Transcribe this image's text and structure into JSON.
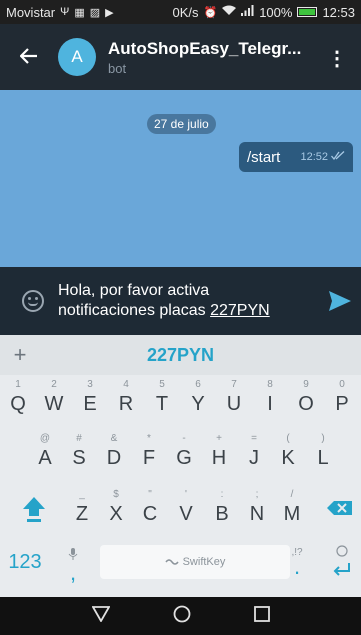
{
  "status": {
    "carrier": "Movistar",
    "speed": "0K/s",
    "battery": "100%",
    "time": "12:53"
  },
  "header": {
    "avatar_letter": "A",
    "title": "AutoShopEasy_Telegr...",
    "subtitle": "bot"
  },
  "chat": {
    "date": "27 de julio",
    "messages": [
      {
        "text": "/start",
        "time": "12:52"
      }
    ]
  },
  "composer": {
    "line1": "Hola, por favor activa",
    "line2_prefix": "notificaciones placas ",
    "line2_underlined": "227PYN"
  },
  "keyboard": {
    "suggestion": "227PYN",
    "plus": "+",
    "row1": [
      {
        "sub": "1",
        "key": "Q"
      },
      {
        "sub": "2",
        "key": "W"
      },
      {
        "sub": "3",
        "key": "E"
      },
      {
        "sub": "4",
        "key": "R"
      },
      {
        "sub": "5",
        "key": "T"
      },
      {
        "sub": "6",
        "key": "Y"
      },
      {
        "sub": "7",
        "key": "U"
      },
      {
        "sub": "8",
        "key": "I"
      },
      {
        "sub": "9",
        "key": "O"
      },
      {
        "sub": "0",
        "key": "P"
      }
    ],
    "row2": [
      {
        "sub": "@",
        "key": "A"
      },
      {
        "sub": "#",
        "key": "S"
      },
      {
        "sub": "&",
        "key": "D"
      },
      {
        "sub": "*",
        "key": "F"
      },
      {
        "sub": "-",
        "key": "G"
      },
      {
        "sub": "+",
        "key": "H"
      },
      {
        "sub": "=",
        "key": "J"
      },
      {
        "sub": "(",
        "key": "K"
      },
      {
        "sub": ")",
        "key": "L"
      }
    ],
    "row3": [
      {
        "sub": "_",
        "key": "Z"
      },
      {
        "sub": "$",
        "key": "X"
      },
      {
        "sub": "\"",
        "key": "C"
      },
      {
        "sub": "'",
        "key": "V"
      },
      {
        "sub": ":",
        "key": "B"
      },
      {
        "sub": ";",
        "key": "N"
      },
      {
        "sub": "/",
        "key": "M"
      }
    ],
    "numbers_key": "123",
    "comma": ",",
    "space_brand": "SwiftKey",
    "period_sub": ",!?",
    "period": "."
  },
  "colors": {
    "accent": "#25a3c9",
    "chat_bg": "#6aa7d9",
    "header_bg": "#212a33"
  }
}
